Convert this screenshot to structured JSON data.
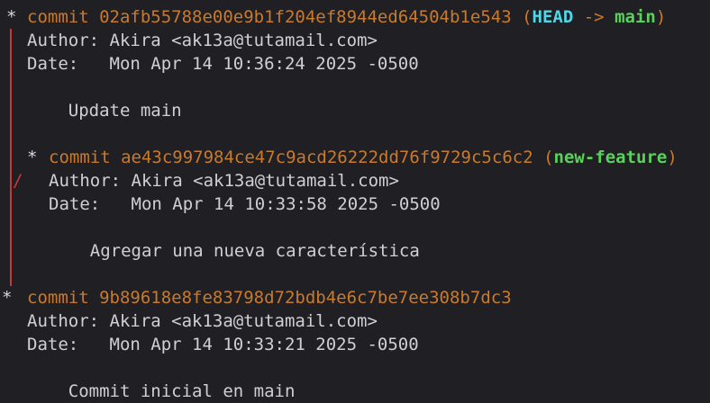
{
  "commits": [
    {
      "hash": "commit 02afb55788e00e9b1f204ef8944ed64504b1e543",
      "refs_open": " (",
      "head": "HEAD",
      "arrow": " -> ",
      "branch": "main",
      "refs_close": ")",
      "author": "Author: Akira <ak13a@tutamail.com>",
      "date": "Date:   Mon Apr 14 10:36:24 2025 -0500",
      "message": "    Update main"
    },
    {
      "hash": "commit ae43c997984ce47c9acd26222dd76f9729c5c6c2",
      "refs_open": " (",
      "branch": "new-feature",
      "refs_close": ")",
      "author": "Author: Akira <ak13a@tutamail.com>",
      "date": "Date:   Mon Apr 14 10:33:58 2025 -0500",
      "message": "    Agregar una nueva característica"
    },
    {
      "hash": "commit 9b89618e8fe83798d72bdb4e6c7be7ee308b7dc3",
      "author": "Author: Akira <ak13a@tutamail.com>",
      "date": "Date:   Mon Apr 14 10:33:21 2025 -0500",
      "message": "    Commit inicial en main"
    }
  ],
  "graph": {
    "star": "*",
    "slash": "/"
  },
  "colors": {
    "background": "#1f1f24",
    "hash": "#c97a2c",
    "head": "#52d6e6",
    "branch": "#5ad25a",
    "graph_line": "#c83a3a",
    "text": "#d0d0d4"
  }
}
